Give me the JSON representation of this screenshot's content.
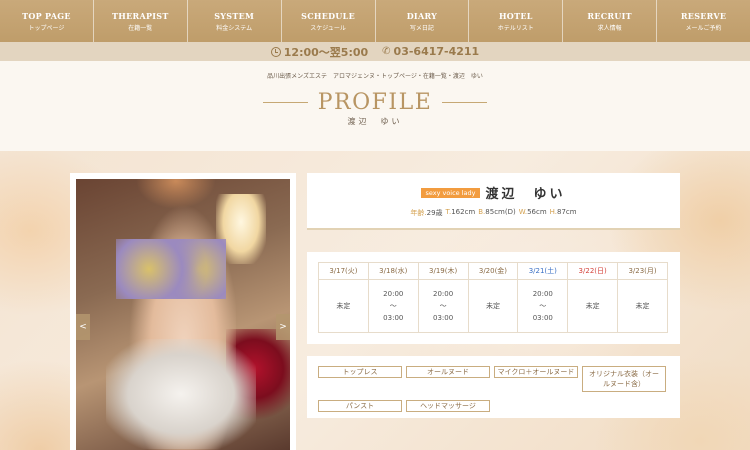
{
  "nav": [
    {
      "en": "TOP PAGE",
      "ja": "トップページ"
    },
    {
      "en": "THERAPIST",
      "ja": "在籍一覧"
    },
    {
      "en": "SYSTEM",
      "ja": "料金システム"
    },
    {
      "en": "SCHEDULE",
      "ja": "スケジュール"
    },
    {
      "en": "DIARY",
      "ja": "写メ日記"
    },
    {
      "en": "HOTEL",
      "ja": "ホテルリスト"
    },
    {
      "en": "RECRUIT",
      "ja": "求人情報"
    },
    {
      "en": "RESERVE",
      "ja": "メールご予約"
    }
  ],
  "hours": {
    "time": "12:00～翌5:00",
    "phone": "03-6417-4211"
  },
  "breadcrumb": "品川出張メンズエステ　アロマジェンヌ・トップページ・在籍一覧・渡辺　ゆい",
  "page_title": "PROFILE",
  "page_subtitle": "渡辺　ゆい",
  "profile": {
    "badge": "sexy voice lady",
    "name": "渡辺　ゆい",
    "age_label": "年齢.",
    "age": "29歳",
    "t_label": "T.",
    "t": "162cm",
    "b_label": "B.",
    "b": "85cm(D)",
    "w_label": "W.",
    "w": "56cm",
    "h_label": "H.",
    "h": "87cm"
  },
  "photo": {
    "prev": "<",
    "next": ">"
  },
  "schedule": {
    "days": [
      {
        "date": "3/17(火)",
        "status": "未定",
        "kind": "weekday"
      },
      {
        "date": "3/18(水)",
        "status": "20:00\n～\n03:00",
        "kind": "weekday"
      },
      {
        "date": "3/19(木)",
        "status": "20:00\n～\n03:00",
        "kind": "weekday"
      },
      {
        "date": "3/20(金)",
        "status": "未定",
        "kind": "weekday"
      },
      {
        "date": "3/21(土)",
        "status": "20:00\n～\n03:00",
        "kind": "sat"
      },
      {
        "date": "3/22(日)",
        "status": "未定",
        "kind": "sun"
      },
      {
        "date": "3/23(月)",
        "status": "未定",
        "kind": "weekday"
      }
    ]
  },
  "options": [
    "トップレス",
    "オールヌード",
    "マイクロ＋オールヌード",
    "オリジナル衣装（オールヌード含）",
    "パンスト",
    "ヘッドマッサージ"
  ]
}
